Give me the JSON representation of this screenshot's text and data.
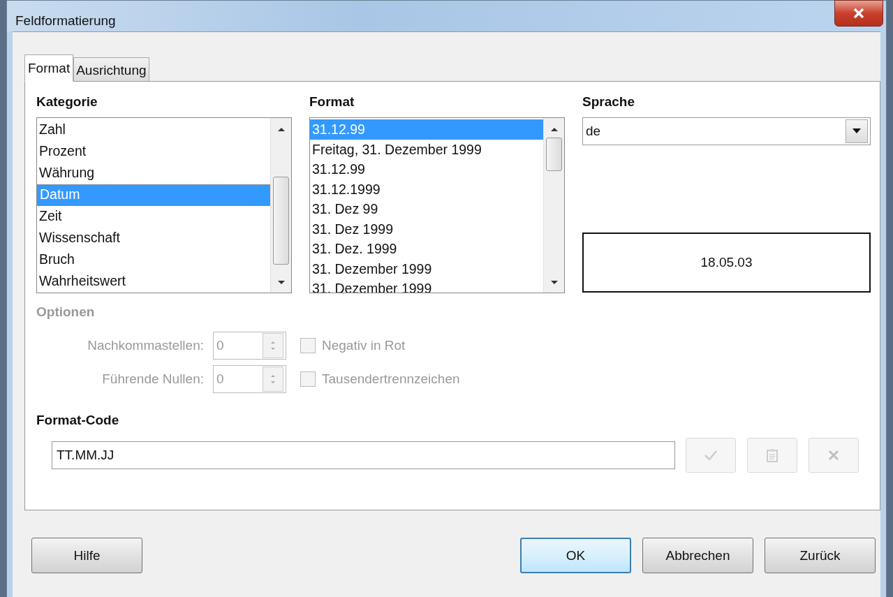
{
  "window": {
    "title": "Feldformatierung"
  },
  "tabs": [
    {
      "label": "Format",
      "selected": true
    },
    {
      "label": "Ausrichtung",
      "selected": false
    }
  ],
  "kategorie": {
    "label": "Kategorie",
    "items": [
      {
        "label": "Zahl",
        "selected": false
      },
      {
        "label": "Prozent",
        "selected": false
      },
      {
        "label": "Währung",
        "selected": false
      },
      {
        "label": "Datum",
        "selected": true
      },
      {
        "label": "Zeit",
        "selected": false
      },
      {
        "label": "Wissenschaft",
        "selected": false
      },
      {
        "label": "Bruch",
        "selected": false
      },
      {
        "label": "Wahrheitswert",
        "selected": false
      }
    ]
  },
  "format": {
    "label": "Format",
    "items": [
      {
        "label": "31.12.99",
        "selected": true
      },
      {
        "label": "Freitag, 31. Dezember 1999",
        "selected": false
      },
      {
        "label": "31.12.99",
        "selected": false
      },
      {
        "label": "31.12.1999",
        "selected": false
      },
      {
        "label": "31. Dez 99",
        "selected": false
      },
      {
        "label": "31. Dez 1999",
        "selected": false
      },
      {
        "label": "31. Dez. 1999",
        "selected": false
      },
      {
        "label": "31. Dezember 1999",
        "selected": false
      },
      {
        "label": "31. Dezember 1999",
        "selected": false
      }
    ]
  },
  "sprache": {
    "label": "Sprache",
    "value": "de"
  },
  "preview": "18.05.03",
  "optionen": {
    "label": "Optionen",
    "disabled": true,
    "fields": [
      {
        "label": "Nachkommastellen:",
        "value": "0"
      },
      {
        "label": "Führende Nullen:",
        "value": "0"
      }
    ],
    "checkboxes": [
      {
        "label": "Negativ in Rot",
        "checked": false
      },
      {
        "label": "Tausendertrennzeichen",
        "checked": false
      }
    ]
  },
  "format_code": {
    "label": "Format-Code",
    "value": "TT.MM.JJ",
    "buttons": [
      {
        "kind": "accept",
        "disabled": true
      },
      {
        "kind": "paste",
        "disabled": true
      },
      {
        "kind": "delete",
        "disabled": true
      }
    ]
  },
  "help_button": {
    "label": "Hilfe"
  },
  "buttons": [
    {
      "label": "OK",
      "default": true
    },
    {
      "label": "Abbrechen",
      "default": false
    },
    {
      "label": "Zurück",
      "default": false
    }
  ]
}
